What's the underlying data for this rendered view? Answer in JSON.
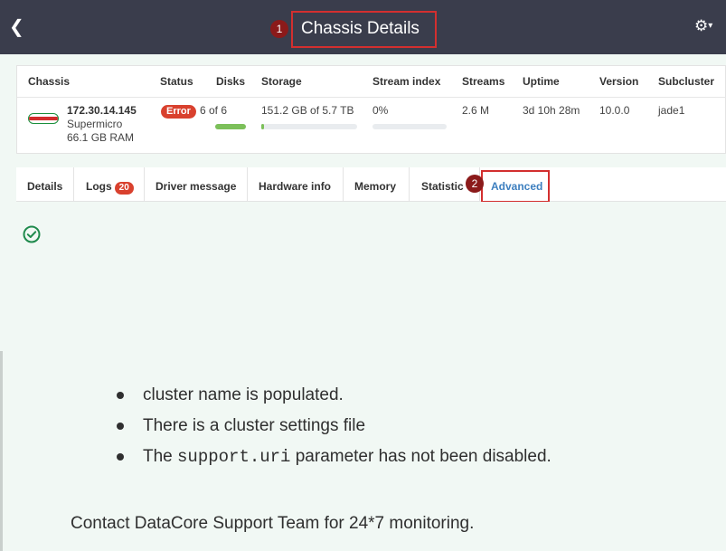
{
  "header": {
    "title": "Chassis Details",
    "back_icon": "chevron-left-icon",
    "settings_icon": "gear-icon",
    "title_marker": "1"
  },
  "table": {
    "columns": [
      "Chassis",
      "Status",
      "Disks",
      "Storage",
      "Stream index",
      "Streams",
      "Uptime",
      "Version",
      "Subcluster"
    ],
    "row": {
      "ip": "172.30.14.145",
      "vendor": "Supermicro",
      "ram": "66.1 GB RAM",
      "status": "Error",
      "disks": "6 of 6",
      "disks_fill": 1.0,
      "storage": "151.2 GB of 5.7 TB",
      "storage_fill": 0.03,
      "stream_index": "0%",
      "stream_index_fill": 0.0,
      "streams": "2.6 M",
      "uptime": "3d 10h 28m",
      "version": "10.0.0",
      "subcluster": "jade1"
    }
  },
  "tabs": [
    {
      "label": "Details"
    },
    {
      "label": "Logs",
      "count": "20"
    },
    {
      "label": "Driver message"
    },
    {
      "label": "Hardware info"
    },
    {
      "label": "Memory"
    },
    {
      "label": "Statistic"
    },
    {
      "label": "Advanced",
      "active": true
    }
  ],
  "advanced_marker": "2",
  "content": {
    "status_icon": "check-circle-icon",
    "bullets": {
      "b1": "cluster name is populated.",
      "b2": "There is a cluster settings file",
      "b3_pre": "The ",
      "b3_code": "support.uri",
      "b3_post": " parameter has not been disabled."
    },
    "contact": "Contact DataCore Support Team for 24*7 monitoring."
  },
  "colors": {
    "header_bg": "#3a3d4c",
    "error": "#d9412e",
    "accent": "#3d7fbf",
    "highlight": "#d32f2f",
    "content_bg": "#f1f8f4",
    "success": "#1f8a4c"
  }
}
